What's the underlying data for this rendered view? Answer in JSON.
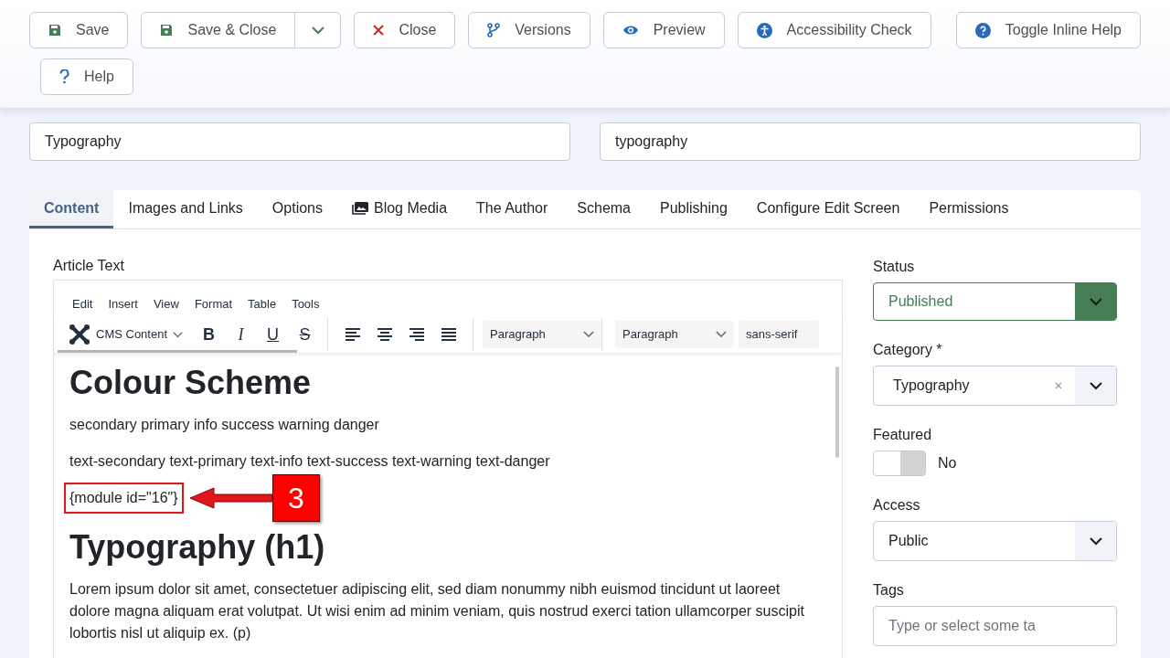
{
  "toolbar": {
    "rows": [
      [
        {
          "label": "Save"
        },
        {
          "label": "Save & Close"
        },
        {
          "label": "Close"
        },
        {
          "label": "Versions"
        },
        {
          "label": "Preview"
        },
        {
          "label": "Accessibility Check"
        },
        {
          "label": "Toggle Inline Help"
        }
      ],
      [
        {
          "label": "Help"
        }
      ]
    ]
  },
  "fields": [
    {
      "value": "Typography"
    },
    {
      "value": "typography"
    }
  ],
  "tabs": [
    {
      "label": "Content",
      "selected": true
    },
    {
      "label": "Images and Links",
      "selected": false
    },
    {
      "label": "Options",
      "selected": false
    },
    {
      "label": "Blog Media",
      "selected": false
    },
    {
      "label": "The Author",
      "selected": false
    },
    {
      "label": "Schema",
      "selected": false
    },
    {
      "label": "Publishing",
      "selected": false
    },
    {
      "label": "Configure Edit Screen",
      "selected": false
    },
    {
      "label": "Permissions",
      "selected": false
    }
  ],
  "editor": {
    "label": "Article Text",
    "menu": [
      "Edit",
      "Insert",
      "View",
      "Format",
      "Table",
      "Tools"
    ],
    "plugin_button": "CMS Content",
    "groups": [
      [
        {
          "kind": "bold",
          "label": "B"
        },
        {
          "kind": "italic",
          "label": "I"
        },
        {
          "kind": "underline",
          "label": "U"
        },
        {
          "kind": "strike",
          "label": "S"
        }
      ],
      [
        {
          "kind": "align-left"
        },
        {
          "kind": "align-center"
        },
        {
          "kind": "align-right"
        },
        {
          "kind": "justify"
        }
      ]
    ],
    "selects": [
      {
        "value": "Paragraph"
      },
      {
        "value": "Paragraph"
      },
      {
        "value": "sans-serif"
      }
    ],
    "content": [
      {
        "kind": "h1",
        "text": "Colour Scheme"
      },
      {
        "kind": "p",
        "text": "secondary primary info success warning danger"
      },
      {
        "kind": "p",
        "text": "text-secondary text-primary text-info text-success text-warning text-danger"
      },
      {
        "kind": "module",
        "text": "{module id=\"16\"}",
        "callout": "3"
      },
      {
        "kind": "h1",
        "text": "Typography (h1)"
      },
      {
        "kind": "p",
        "text": "Lorem ipsum dolor sit amet, consectetuer adipiscing elit, sed diam nonummy nibh euismod tincidunt ut laoreet dolore magna aliquam erat volutpat. Ut wisi enim ad minim veniam, quis nostrud exerci tation ullamcorper suscipit lobortis nisl ut aliquip ex. (p)"
      }
    ]
  },
  "sidebar": [
    {
      "kind": "status",
      "label": "Status",
      "value": "Published"
    },
    {
      "kind": "category",
      "label": "Category *",
      "value": "Typography"
    },
    {
      "kind": "toggle",
      "label": "Featured",
      "on": false,
      "state_text": "No"
    },
    {
      "kind": "select",
      "label": "Access",
      "value": "Public"
    },
    {
      "kind": "tags",
      "label": "Tags",
      "placeholder": "Type or select some ta"
    }
  ]
}
